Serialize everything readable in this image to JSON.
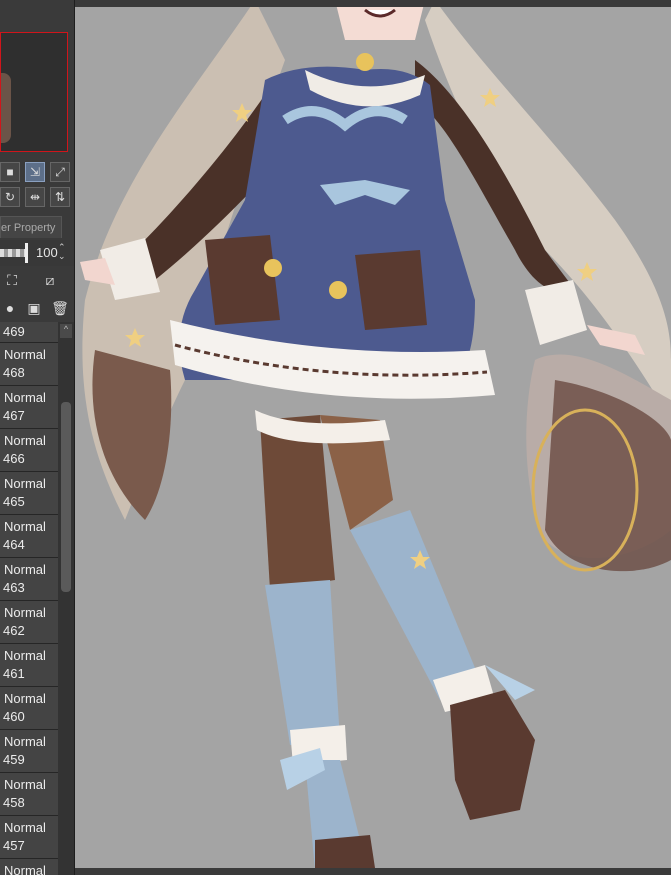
{
  "panel": {
    "tab_label": "er Property",
    "opacity_value": "100",
    "spin_up": "⌃",
    "spin_down": "⌄"
  },
  "layers": [
    {
      "mode": "",
      "num": "469"
    },
    {
      "mode": "Normal",
      "num": "468"
    },
    {
      "mode": "Normal",
      "num": "467"
    },
    {
      "mode": "Normal",
      "num": "466"
    },
    {
      "mode": "Normal",
      "num": "465"
    },
    {
      "mode": "Normal",
      "num": "464"
    },
    {
      "mode": "Normal",
      "num": "463"
    },
    {
      "mode": "Normal",
      "num": "462"
    },
    {
      "mode": "Normal",
      "num": "461"
    },
    {
      "mode": "Normal",
      "num": "460"
    },
    {
      "mode": "Normal",
      "num": "459"
    },
    {
      "mode": "Normal",
      "num": "458"
    },
    {
      "mode": "Normal",
      "num": "457"
    },
    {
      "mode": "Normal",
      "num": ""
    }
  ],
  "icons": {
    "tool_row1": [
      "stop-icon",
      "transform-icon",
      "fit-icon"
    ],
    "tool_row2": [
      "rotate-icon",
      "flip-horizontal-icon",
      "flip-vertical-icon"
    ],
    "layer_row1": [
      "lock-icon",
      "clip-icon"
    ],
    "layer_row2": [
      "layer-mask-icon",
      "new-folder-icon",
      "delete-icon"
    ]
  },
  "colors": {
    "panel_bg": "#3a3a3a",
    "canvas_bg": "#a4a4a4",
    "navigator_border": "#d0151b",
    "dress_blue": "#4d5a8f",
    "ribbon_blue": "#a9c6de",
    "hair": "#d8cfc4",
    "sleeve_brown": "#4a3128"
  }
}
